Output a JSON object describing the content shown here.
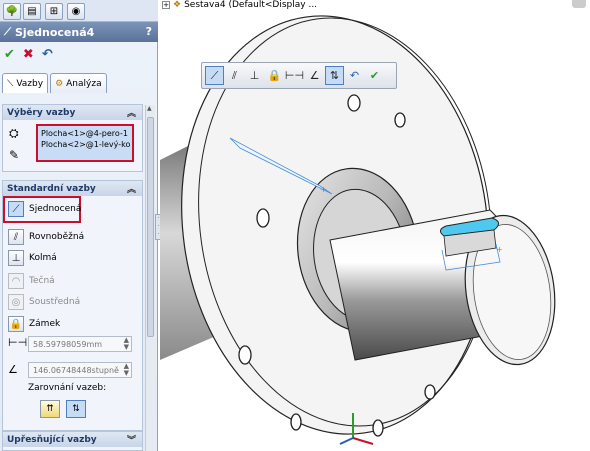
{
  "panel": {
    "top_tabs": [
      "feature-manager-icon",
      "property-manager-icon",
      "configuration-manager-icon",
      "appearance-icon"
    ],
    "title": "Sjednocená4",
    "help": "?",
    "actions": {
      "ok": "✔",
      "cancel": "✖",
      "undo": "↶"
    },
    "subtabs": [
      {
        "label": "Vazby",
        "icon": "mates-icon"
      },
      {
        "label": "Analýza",
        "icon": "analysis-icon"
      }
    ],
    "selections": {
      "header": "Výběry vazby",
      "items": [
        "Plocha<1>@4-pero-1",
        "Plocha<2>@1-levý-ko"
      ]
    },
    "standard": {
      "header": "Standardní vazby",
      "mates": [
        {
          "label": "Sjednocená",
          "icon": "coincident-icon",
          "enabled": true,
          "selected": true
        },
        {
          "label": "Rovnoběžná",
          "icon": "parallel-icon",
          "enabled": true
        },
        {
          "label": "Kolmá",
          "icon": "perpendicular-icon",
          "enabled": true
        },
        {
          "label": "Tečná",
          "icon": "tangent-icon",
          "enabled": false
        },
        {
          "label": "Soustředná",
          "icon": "concentric-icon",
          "enabled": false
        },
        {
          "label": "Zámek",
          "icon": "lock-icon",
          "enabled": true
        }
      ],
      "distance_value": "58.59798059mm",
      "angle_value": "146.06748448stupně",
      "alignment_label": "Zarovnání vazeb:"
    },
    "advanced": {
      "header": "Upřesňující vazby"
    }
  },
  "viewport": {
    "tree_label": "Sestava4  (Default<Display ...",
    "toolbar_selected": "coincident"
  },
  "colors": {
    "title_bar": "#5a7299",
    "highlight_red": "#c8102e",
    "selection_fill": "#c9dcf6",
    "face_highlight": "#4fc8f0"
  }
}
